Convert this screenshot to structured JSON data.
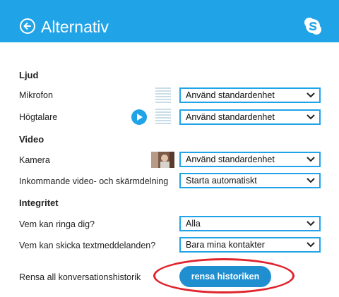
{
  "header": {
    "title": "Alternativ",
    "back_icon": "back-arrow-circle-icon",
    "logo_icon": "skype-logo-icon",
    "accent": "#21a3e8"
  },
  "sound": {
    "heading": "Ljud",
    "microphone": {
      "label": "Mikrofon",
      "value": "Använd standardenhet"
    },
    "speaker": {
      "label": "Högtalare",
      "value": "Använd standardenhet"
    }
  },
  "video": {
    "heading": "Video",
    "camera": {
      "label": "Kamera",
      "value": "Använd standardenhet"
    },
    "incoming": {
      "label": "Inkommande video- och skärmdelning",
      "value": "Starta automatiskt"
    }
  },
  "privacy": {
    "heading": "Integritet",
    "who_calls": {
      "label": "Vem kan ringa dig?",
      "value": "Alla"
    },
    "who_messages": {
      "label": "Vem kan skicka textmeddelanden?",
      "value": "Bara mina kontakter"
    },
    "clear_history": {
      "label": "Rensa all konversationshistorik",
      "button": "rensa historiken"
    }
  },
  "colors": {
    "highlight": "#e0232b",
    "button": "#1f8fd0"
  }
}
